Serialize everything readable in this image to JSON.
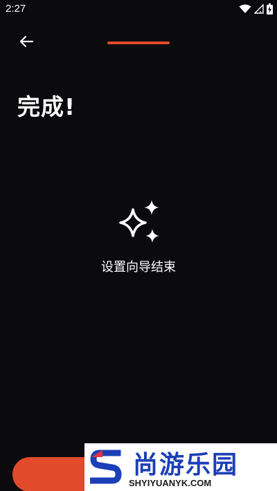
{
  "status_bar": {
    "time": "2:27",
    "icons": [
      "wifi-icon",
      "signal-icon",
      "battery-charging-icon"
    ]
  },
  "header": {
    "back_icon": "arrow-left-icon"
  },
  "progress": {
    "value": 1.0,
    "color": "#e24a2c"
  },
  "main": {
    "title": "完成!",
    "icon": "sparkles-icon",
    "message": "设置向导结束"
  },
  "footer": {
    "button_color": "#e24a2c"
  },
  "watermark": {
    "title": "尚游乐园",
    "url": "SHYIYUANYK.COM",
    "brand_color": "#1c3fb8",
    "accent_color": "#e8313c"
  },
  "colors": {
    "background": "#0b0b0e",
    "accent": "#e24a2c",
    "text": "#ffffff"
  }
}
